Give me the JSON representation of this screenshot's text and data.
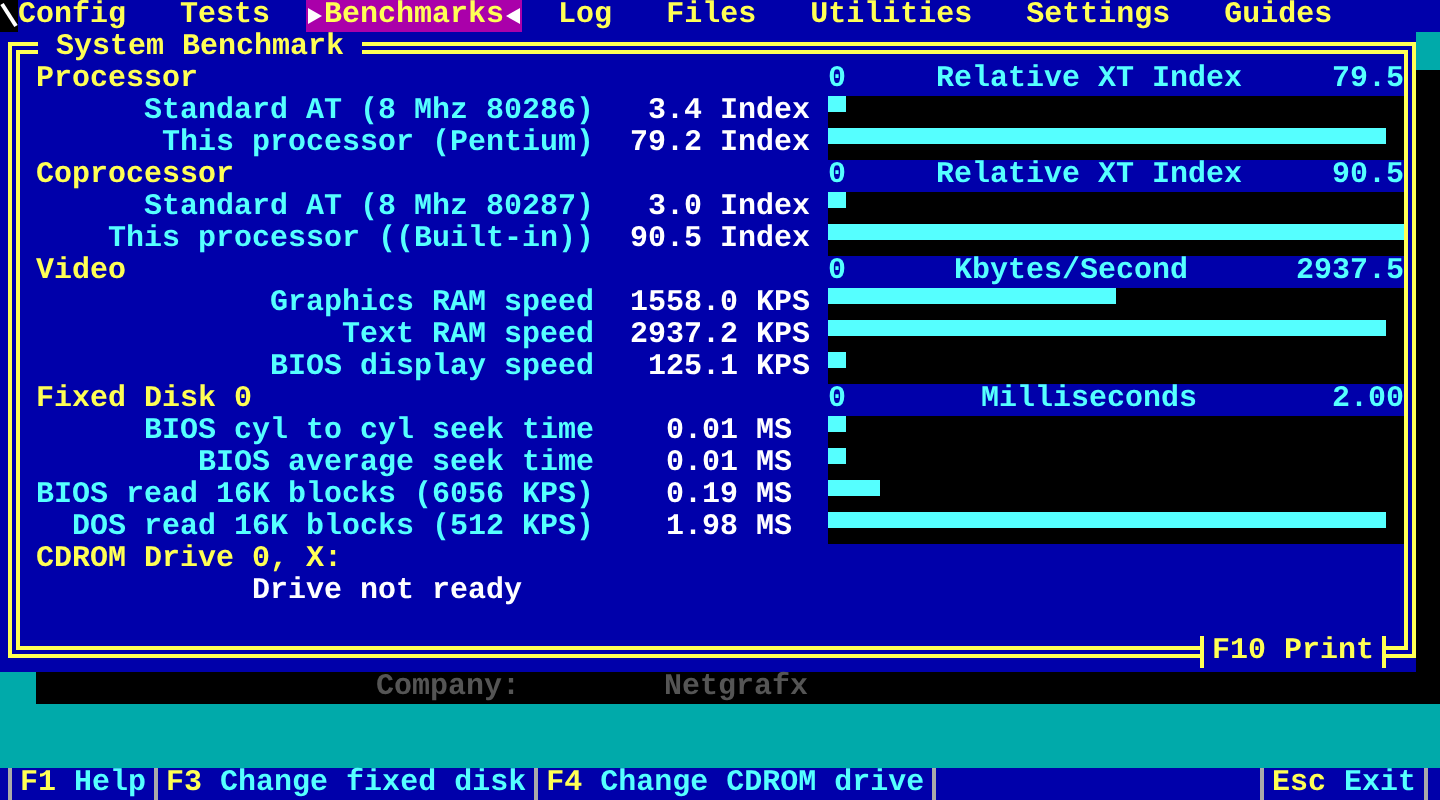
{
  "menu": [
    {
      "label": "Config",
      "selected": false
    },
    {
      "label": "Tests",
      "selected": false
    },
    {
      "label": "Benchmarks",
      "selected": true
    },
    {
      "label": "Log",
      "selected": false
    },
    {
      "label": "Files",
      "selected": false
    },
    {
      "label": "Utilities",
      "selected": false
    },
    {
      "label": "Settings",
      "selected": false
    },
    {
      "label": "Guides",
      "selected": false
    }
  ],
  "panel": {
    "title": "System Benchmark",
    "sections": [
      {
        "title": "Processor",
        "chart": {
          "min": "0",
          "label": "Relative XT Index",
          "max": "79.5"
        },
        "rows": [
          {
            "label": "Standard AT (8 Mhz 80286)",
            "value": "3.4",
            "unit": "Index",
            "level": 0.03
          },
          {
            "label": "This processor (Pentium)",
            "value": "79.2",
            "unit": "Index",
            "level": 0.97
          }
        ]
      },
      {
        "title": "Coprocessor",
        "chart": {
          "min": "0",
          "label": "Relative XT Index",
          "max": "90.5"
        },
        "rows": [
          {
            "label": "Standard AT (8 Mhz 80287)",
            "value": "3.0",
            "unit": "Index",
            "level": 0.03
          },
          {
            "label": "This processor ((Built-in))",
            "value": "90.5",
            "unit": "Index",
            "level": 1.0
          }
        ]
      },
      {
        "title": "Video",
        "chart": {
          "min": "0",
          "label": "Kbytes/Second",
          "max": "2937.5"
        },
        "rows": [
          {
            "label": "Graphics RAM speed",
            "value": "1558.0",
            "unit": "KPS",
            "level": 0.5
          },
          {
            "label": "Text RAM speed",
            "value": "2937.2",
            "unit": "KPS",
            "level": 0.97
          },
          {
            "label": "BIOS display speed",
            "value": "125.1",
            "unit": "KPS",
            "level": 0.03
          }
        ]
      },
      {
        "title": "Fixed Disk 0",
        "chart": {
          "min": "0",
          "label": "Milliseconds",
          "max": "2.00"
        },
        "rows": [
          {
            "label": "BIOS cyl to cyl seek time",
            "value": "0.01",
            "unit": "MS",
            "level": 0.03
          },
          {
            "label": "BIOS average seek time",
            "value": "0.01",
            "unit": "MS",
            "level": 0.03
          },
          {
            "label": "BIOS read 16K blocks (6056 KPS)",
            "value": "0.19",
            "unit": "MS",
            "level": 0.09
          },
          {
            "label": "DOS read 16K blocks (512 KPS)",
            "value": "1.98",
            "unit": "MS",
            "level": 0.97
          }
        ]
      },
      {
        "title": "CDROM Drive 0, X:",
        "message": "Drive not ready"
      }
    ],
    "print_key": {
      "key": "F10",
      "label": "Print"
    }
  },
  "status": {
    "label": "Company:",
    "value": "Netgrafx"
  },
  "function_keys": [
    {
      "key": "F1",
      "label": "Help"
    },
    {
      "key": "F3",
      "label": "Change fixed disk"
    },
    {
      "key": "F4",
      "label": "Change CDROM drive"
    }
  ],
  "exit_key": {
    "key": "Esc",
    "label": "Exit"
  }
}
